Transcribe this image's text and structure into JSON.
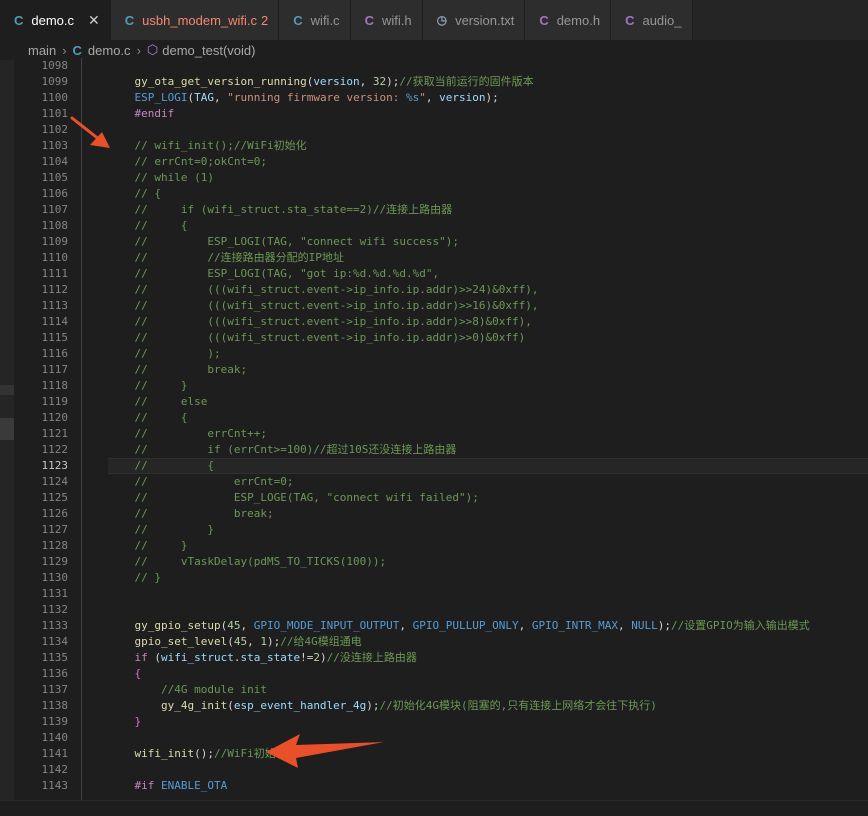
{
  "tabs": [
    {
      "icon": "C",
      "icon_type": "c",
      "label": "demo.c",
      "state": "active",
      "close": "✕",
      "badge": ""
    },
    {
      "icon": "C",
      "icon_type": "c",
      "label": "usbh_modem_wifi.c",
      "state": "err",
      "badge": "2"
    },
    {
      "icon": "C",
      "icon_type": "c",
      "label": "wifi.c",
      "state": "",
      "badge": ""
    },
    {
      "icon": "C",
      "icon_type": "h",
      "label": "wifi.h",
      "state": "",
      "badge": ""
    },
    {
      "icon": "◷",
      "icon_type": "txt",
      "label": "version.txt",
      "state": "",
      "badge": ""
    },
    {
      "icon": "C",
      "icon_type": "h",
      "label": "demo.h",
      "state": "",
      "badge": ""
    },
    {
      "icon": "C",
      "icon_type": "h",
      "label": "audio_",
      "state": "",
      "badge": ""
    }
  ],
  "breadcrumb": {
    "folder": "main",
    "file_icon": "C",
    "file": "demo.c",
    "symbol": "demo_test(void)"
  },
  "current_line": 1123,
  "lines": [
    {
      "n": 1098,
      "t": []
    },
    {
      "n": 1099,
      "t": [
        [
          "",
          "    "
        ],
        [
          "fn",
          "gy_ota_get_version_running"
        ],
        [
          "",
          "("
        ],
        [
          "var",
          "version"
        ],
        [
          "",
          ", "
        ],
        [
          "num",
          "32"
        ],
        [
          "",
          ");"
        ],
        [
          "cm",
          "//获取当前运行的固件版本"
        ]
      ]
    },
    {
      "n": 1100,
      "t": [
        [
          "",
          "    "
        ],
        [
          "mac",
          "ESP_LOGI"
        ],
        [
          "",
          "("
        ],
        [
          "var",
          "TAG"
        ],
        [
          "",
          ", "
        ],
        [
          "str",
          "\"running firmware version: "
        ],
        [
          "mac",
          "%s"
        ],
        [
          "str",
          "\""
        ],
        [
          "",
          ", "
        ],
        [
          "var",
          "version"
        ],
        [
          "",
          ");"
        ]
      ]
    },
    {
      "n": 1101,
      "t": [
        [
          "",
          "    "
        ],
        [
          "kw",
          "#endif"
        ]
      ]
    },
    {
      "n": 1102,
      "t": []
    },
    {
      "n": 1103,
      "t": [
        [
          "",
          "    "
        ],
        [
          "cm",
          "// wifi_init();//WiFi初始化"
        ]
      ]
    },
    {
      "n": 1104,
      "t": [
        [
          "",
          "    "
        ],
        [
          "cm",
          "// errCnt=0;okCnt=0;"
        ]
      ]
    },
    {
      "n": 1105,
      "t": [
        [
          "",
          "    "
        ],
        [
          "cm",
          "// while (1)"
        ]
      ]
    },
    {
      "n": 1106,
      "t": [
        [
          "",
          "    "
        ],
        [
          "cm",
          "// {"
        ]
      ]
    },
    {
      "n": 1107,
      "t": [
        [
          "",
          "    "
        ],
        [
          "cm",
          "//     if (wifi_struct.sta_state==2)//连接上路由器"
        ]
      ]
    },
    {
      "n": 1108,
      "t": [
        [
          "",
          "    "
        ],
        [
          "cm",
          "//     {"
        ]
      ]
    },
    {
      "n": 1109,
      "t": [
        [
          "",
          "    "
        ],
        [
          "cm",
          "//         ESP_LOGI(TAG, \"connect wifi success\");"
        ]
      ]
    },
    {
      "n": 1110,
      "t": [
        [
          "",
          "    "
        ],
        [
          "cm",
          "//         //连接路由器分配的IP地址"
        ]
      ]
    },
    {
      "n": 1111,
      "t": [
        [
          "",
          "    "
        ],
        [
          "cm",
          "//         ESP_LOGI(TAG, \"got ip:%d.%d.%d.%d\","
        ]
      ]
    },
    {
      "n": 1112,
      "t": [
        [
          "",
          "    "
        ],
        [
          "cm",
          "//         (((wifi_struct.event->ip_info.ip.addr)>>24)&0xff),"
        ]
      ]
    },
    {
      "n": 1113,
      "t": [
        [
          "",
          "    "
        ],
        [
          "cm",
          "//         (((wifi_struct.event->ip_info.ip.addr)>>16)&0xff),"
        ]
      ]
    },
    {
      "n": 1114,
      "t": [
        [
          "",
          "    "
        ],
        [
          "cm",
          "//         (((wifi_struct.event->ip_info.ip.addr)>>8)&0xff),"
        ]
      ]
    },
    {
      "n": 1115,
      "t": [
        [
          "",
          "    "
        ],
        [
          "cm",
          "//         (((wifi_struct.event->ip_info.ip.addr)>>0)&0xff)"
        ]
      ]
    },
    {
      "n": 1116,
      "t": [
        [
          "",
          "    "
        ],
        [
          "cm",
          "//         );"
        ]
      ]
    },
    {
      "n": 1117,
      "t": [
        [
          "",
          "    "
        ],
        [
          "cm",
          "//         break;"
        ]
      ]
    },
    {
      "n": 1118,
      "t": [
        [
          "",
          "    "
        ],
        [
          "cm",
          "//     }"
        ]
      ]
    },
    {
      "n": 1119,
      "t": [
        [
          "",
          "    "
        ],
        [
          "cm",
          "//     else"
        ]
      ]
    },
    {
      "n": 1120,
      "t": [
        [
          "",
          "    "
        ],
        [
          "cm",
          "//     {"
        ]
      ]
    },
    {
      "n": 1121,
      "t": [
        [
          "",
          "    "
        ],
        [
          "cm",
          "//         errCnt++;"
        ]
      ]
    },
    {
      "n": 1122,
      "t": [
        [
          "",
          "    "
        ],
        [
          "cm",
          "//         if (errCnt>=100)//超过10S还没连接上路由器"
        ]
      ]
    },
    {
      "n": 1123,
      "t": [
        [
          "",
          "    "
        ],
        [
          "cm",
          "//         {"
        ]
      ]
    },
    {
      "n": 1124,
      "t": [
        [
          "",
          "    "
        ],
        [
          "cm",
          "//             errCnt=0;"
        ]
      ]
    },
    {
      "n": 1125,
      "t": [
        [
          "",
          "    "
        ],
        [
          "cm",
          "//             ESP_LOGE(TAG, \"connect wifi failed\");"
        ]
      ]
    },
    {
      "n": 1126,
      "t": [
        [
          "",
          "    "
        ],
        [
          "cm",
          "//             break;"
        ]
      ]
    },
    {
      "n": 1127,
      "t": [
        [
          "",
          "    "
        ],
        [
          "cm",
          "//         }"
        ]
      ]
    },
    {
      "n": 1128,
      "t": [
        [
          "",
          "    "
        ],
        [
          "cm",
          "//     }"
        ]
      ]
    },
    {
      "n": 1129,
      "t": [
        [
          "",
          "    "
        ],
        [
          "cm",
          "//     vTaskDelay(pdMS_TO_TICKS(100));"
        ]
      ]
    },
    {
      "n": 1130,
      "t": [
        [
          "",
          "    "
        ],
        [
          "cm",
          "// }"
        ]
      ]
    },
    {
      "n": 1131,
      "t": []
    },
    {
      "n": 1132,
      "t": []
    },
    {
      "n": 1133,
      "t": [
        [
          "",
          "    "
        ],
        [
          "fn",
          "gy_gpio_setup"
        ],
        [
          "",
          "("
        ],
        [
          "num",
          "45"
        ],
        [
          "",
          ", "
        ],
        [
          "mac",
          "GPIO_MODE_INPUT_OUTPUT"
        ],
        [
          "",
          ", "
        ],
        [
          "mac",
          "GPIO_PULLUP_ONLY"
        ],
        [
          "",
          ", "
        ],
        [
          "mac",
          "GPIO_INTR_MAX"
        ],
        [
          "",
          ", "
        ],
        [
          "mac",
          "NULL"
        ],
        [
          "",
          ");"
        ],
        [
          "cm",
          "//设置GPIO为输入输出模式"
        ]
      ]
    },
    {
      "n": 1134,
      "t": [
        [
          "",
          "    "
        ],
        [
          "fn",
          "gpio_set_level"
        ],
        [
          "",
          "("
        ],
        [
          "num",
          "45"
        ],
        [
          "",
          ", "
        ],
        [
          "num",
          "1"
        ],
        [
          "",
          ");"
        ],
        [
          "cm",
          "//给4G模组通电"
        ]
      ]
    },
    {
      "n": 1135,
      "t": [
        [
          "",
          "    "
        ],
        [
          "kw",
          "if"
        ],
        [
          "",
          " ("
        ],
        [
          "var",
          "wifi_struct"
        ],
        [
          "",
          "."
        ],
        [
          "var",
          "sta_state"
        ],
        [
          "",
          "!="
        ],
        [
          "num",
          "2"
        ],
        [
          "",
          ")"
        ],
        [
          "cm",
          "//没连接上路由器"
        ]
      ]
    },
    {
      "n": 1136,
      "t": [
        [
          "",
          "    "
        ],
        [
          "br",
          "{"
        ]
      ]
    },
    {
      "n": 1137,
      "t": [
        [
          "",
          "        "
        ],
        [
          "cm",
          "//4G module init"
        ]
      ]
    },
    {
      "n": 1138,
      "t": [
        [
          "",
          "        "
        ],
        [
          "fn",
          "gy_4g_init"
        ],
        [
          "",
          "("
        ],
        [
          "var",
          "esp_event_handler_4g"
        ],
        [
          "",
          ");"
        ],
        [
          "cm",
          "//初始化4G模块(阻塞的,只有连接上网络才会往下执行)"
        ]
      ]
    },
    {
      "n": 1139,
      "t": [
        [
          "",
          "    "
        ],
        [
          "br",
          "}"
        ]
      ]
    },
    {
      "n": 1140,
      "t": []
    },
    {
      "n": 1141,
      "t": [
        [
          "",
          "    "
        ],
        [
          "fn",
          "wifi_init"
        ],
        [
          "",
          "();"
        ],
        [
          "cm",
          "//WiFi初始化"
        ]
      ]
    },
    {
      "n": 1142,
      "t": []
    },
    {
      "n": 1143,
      "t": [
        [
          "",
          "    "
        ],
        [
          "kw",
          "#if"
        ],
        [
          "",
          " "
        ],
        [
          "mac",
          "ENABLE_OTA"
        ]
      ]
    }
  ],
  "colors": {
    "editor_bg": "#1e1e1e",
    "comment": "#6a9955",
    "function": "#dcdcaa",
    "variable": "#9cdcfe",
    "number": "#b5cea8",
    "string": "#ce9178",
    "keyword": "#c586c0",
    "macro": "#569cd6",
    "arrow": "#e8502a"
  },
  "annotations": [
    {
      "name": "red-arrow",
      "points_to_line": 1103
    },
    {
      "name": "red-arrow",
      "points_to_line": 1141
    }
  ]
}
